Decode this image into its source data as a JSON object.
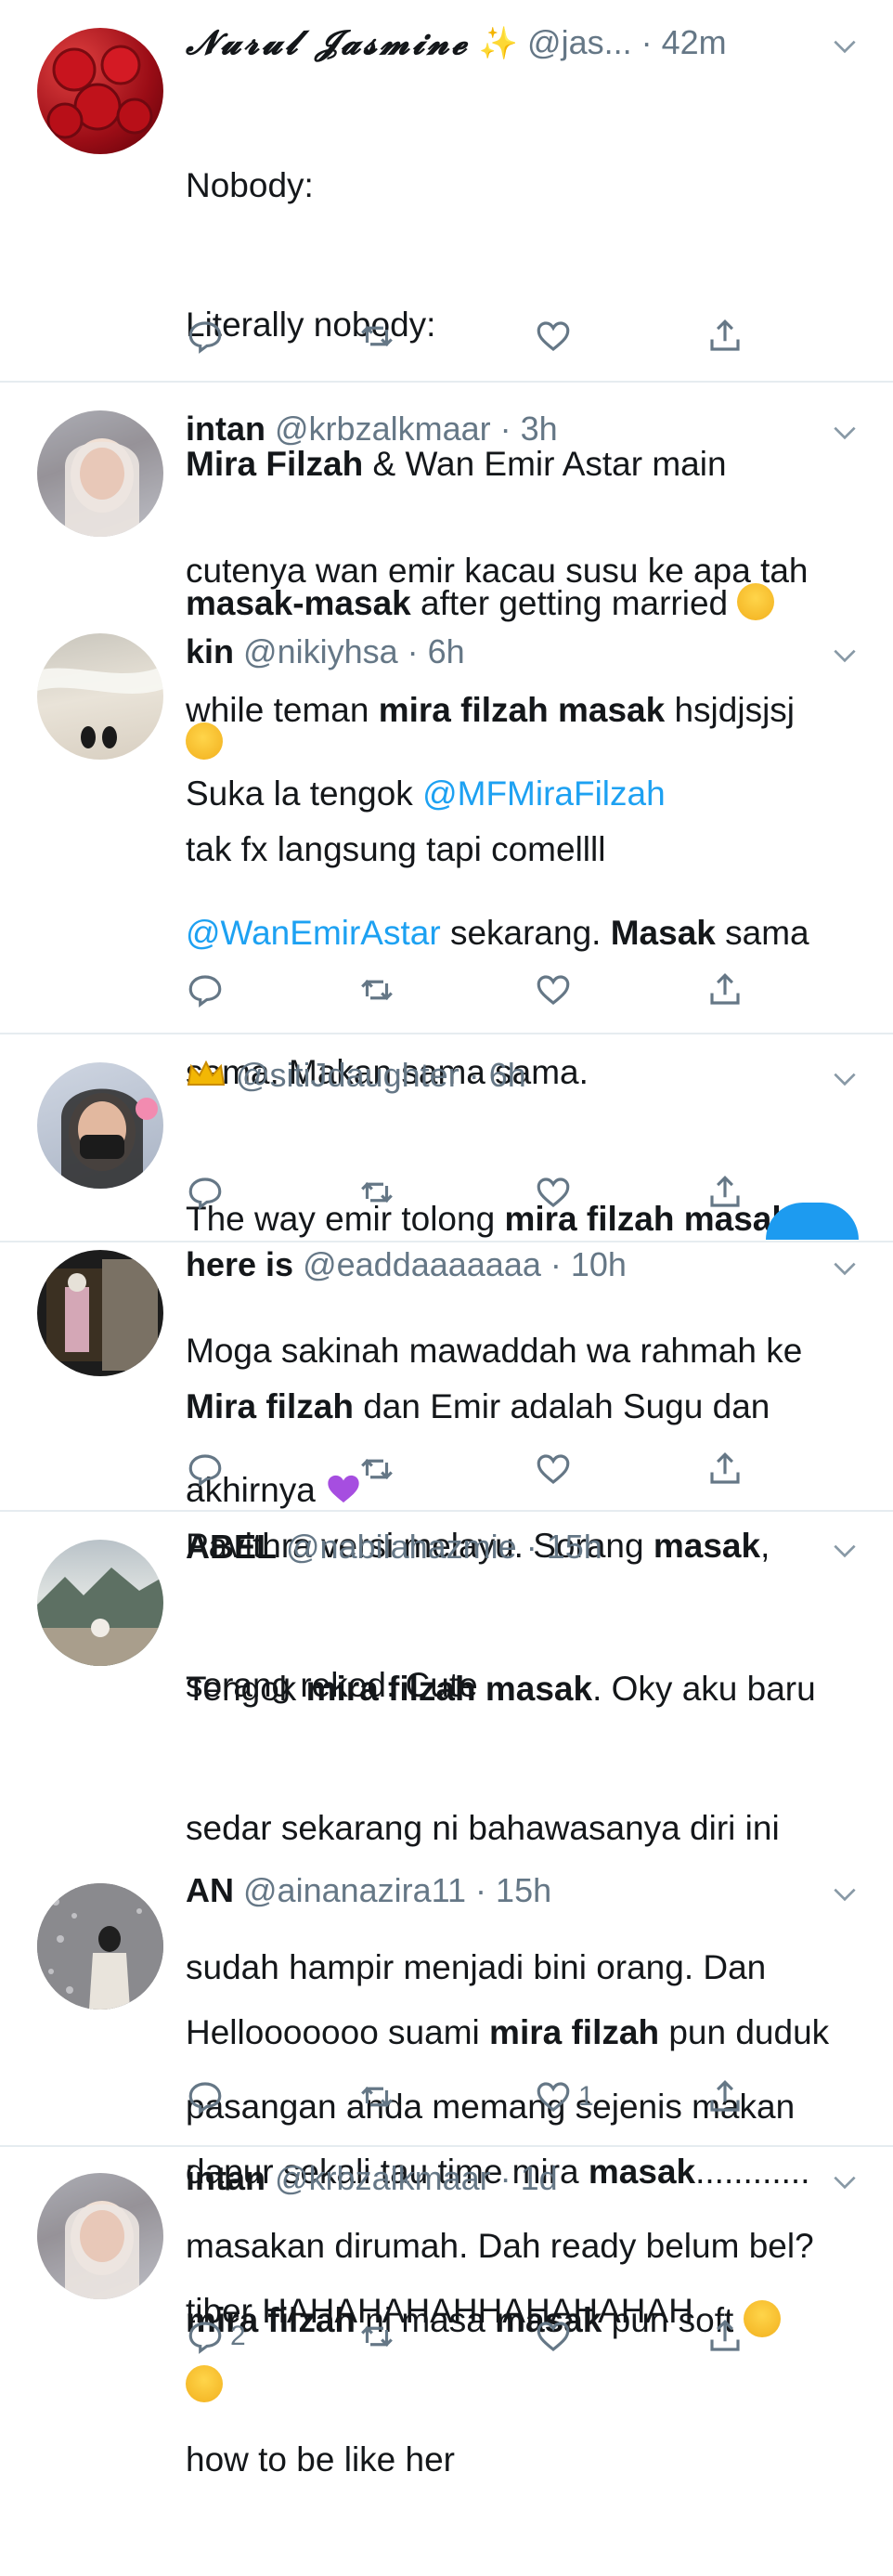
{
  "colors": {
    "accent": "#1da1f2",
    "text": "#14171a",
    "muted": "#657786",
    "divider": "#e6ecf0"
  },
  "tweets": [
    {
      "name": "𝓝𝓾𝓻𝓾𝓵 𝓙𝓪𝓼𝓶𝓲𝓷𝓮",
      "handle": "@jas...",
      "time": "42m",
      "lines": [
        "Nobody:",
        "Literally nobody:"
      ],
      "line3_bold_a": "Mira Filzah",
      "line3_rest": " & Wan Emir Astar main",
      "line4_bold": "masak-masak",
      "line4_rest": " after getting married"
    },
    {
      "name": "intan",
      "handle": "@krbzalkmaar",
      "time": "3h",
      "line1": "cutenya wan emir kacau susu ke apa tah",
      "line2_a": "while teman ",
      "line2_bold": "mira filzah masak",
      "line2_b": " hsjdjsjsj",
      "line3": "tak fx langsung tapi comellll"
    },
    {
      "name": "kin",
      "handle": "@nikiyhsa",
      "time": "6h",
      "line1_a": "Suka la tengok ",
      "mention1": "@MFMiraFilzah",
      "mention2": "@WanEmirAstar",
      "line2_b": " sekarang. ",
      "line2_bold": "Masak",
      "line2_c": " sama",
      "line3": "sama. Makan sama sama.",
      "line4": "Moga sakinah mawaddah wa rahmah ke",
      "line5": "akhirnya"
    },
    {
      "handle": "@sitiJdaughter",
      "time": "6h",
      "line1_a": "The way emir tolong ",
      "line1_bold": "mira filzah masak"
    },
    {
      "name": "here is",
      "handle": "@eaddaaaaaaa",
      "time": "10h",
      "line1_bold": "Mira filzah",
      "line1_rest": " dan Emir adalah Sugu dan",
      "line2_a": "Pavithra versi melayu. Sorang ",
      "line2_bold": "masak",
      "line2_b": ",",
      "line3": "sorang rekod. Cute"
    },
    {
      "name": "ABEL",
      "handle": "@nabilahazmie",
      "time": "15h",
      "line1_a": "Tengok ",
      "line1_bold": "mira filzah masak",
      "line1_b": ". Oky aku baru",
      "line2": "sedar sekarang ni bahawasanya diri ini",
      "line3": "sudah hampir menjadi bini orang. Dan",
      "line4": "pasangan anda memang sejenis makan",
      "line5": "masakan dirumah. Dah ready belum bel?"
    },
    {
      "name": "AN",
      "handle": "@ainanazira11",
      "time": "15h",
      "line1_a": "Hellooooooo suami ",
      "line1_bold": "mira filzah",
      "line1_b": " pun duduk",
      "line2_a": "dapur sekali tau time mira ",
      "line2_bold": "masak",
      "line2_b": "............",
      "line3": "tiber HAHAHAHAHHAHAHAHAH",
      "likes": "1"
    },
    {
      "name": "intan",
      "handle": "@krbzalkmaar",
      "time": "1d",
      "line1_bold_a": "mira filzah",
      "line1_a": " ni masa ",
      "line1_bold_b": "masak",
      "line1_b": " pun soft",
      "line2": "how to be like her",
      "replies": "2"
    }
  ],
  "separator": " · "
}
